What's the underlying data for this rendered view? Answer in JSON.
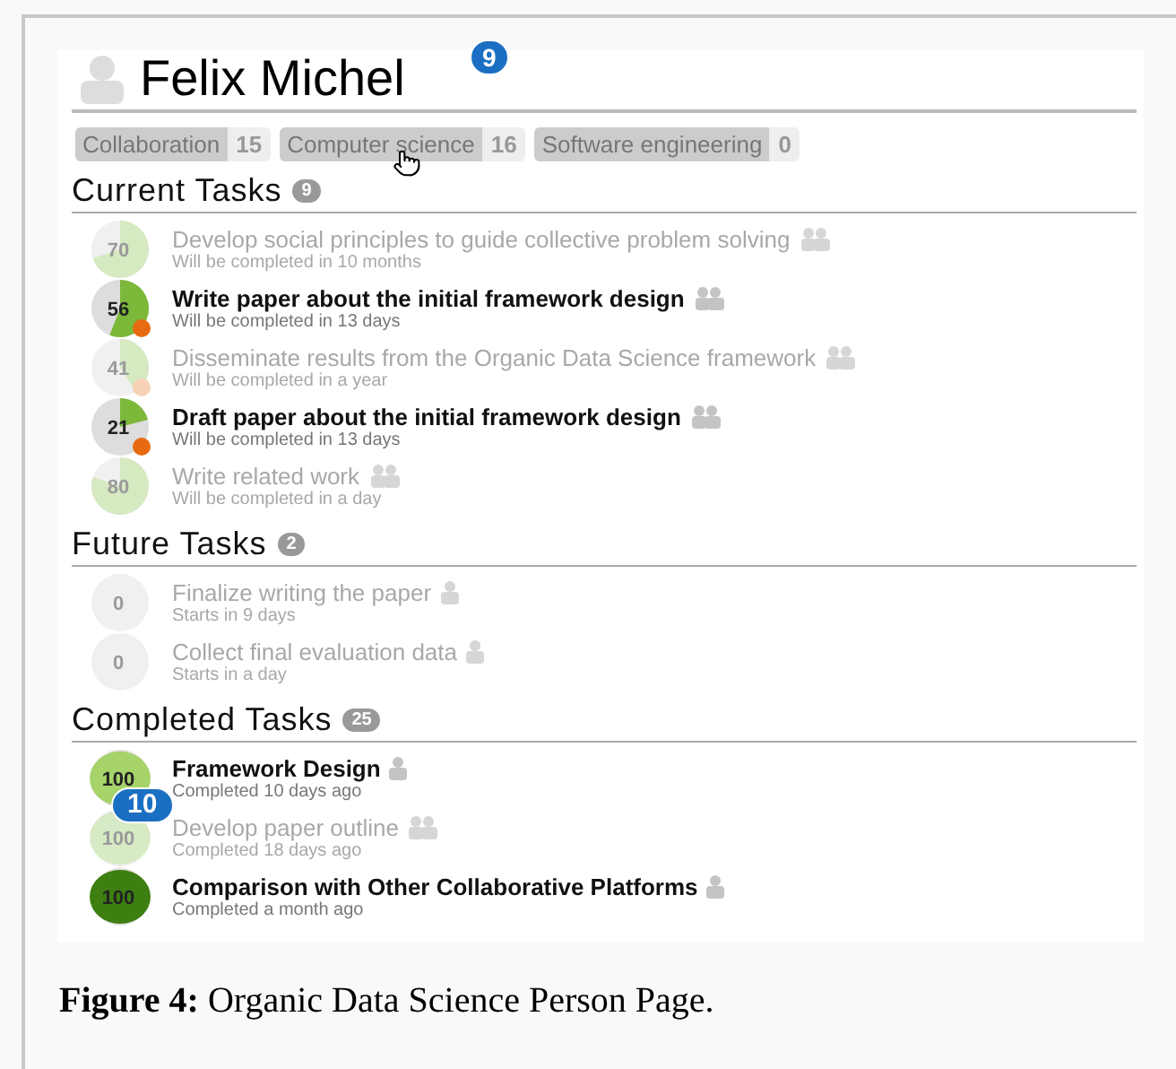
{
  "person": {
    "name": "Felix Michel",
    "callout": "9"
  },
  "tags": [
    {
      "label": "Collaboration",
      "count": "15",
      "hovered": false
    },
    {
      "label": "Computer science",
      "count": "16",
      "hovered": true
    },
    {
      "label": "Software engineering",
      "count": "0",
      "hovered": false
    }
  ],
  "sections": [
    {
      "title": "Current Tasks",
      "count": "9",
      "tasks": [
        {
          "progress": "70",
          "faded": true,
          "team": true,
          "title": "Develop social principles to guide collective problem solving",
          "subtitle": "Will be completed in 10 months"
        },
        {
          "progress": "56",
          "faded": false,
          "late": true,
          "team": true,
          "title": "Write paper about the initial framework design",
          "subtitle": "Will be completed in 13 days"
        },
        {
          "progress": "41",
          "faded": true,
          "late": true,
          "team": true,
          "title": "Disseminate results from the Organic Data Science framework",
          "subtitle": "Will be completed in a year"
        },
        {
          "progress": "21",
          "faded": false,
          "late": true,
          "team": true,
          "title": "Draft paper about the initial framework design",
          "subtitle": "Will be completed in 13 days"
        },
        {
          "progress": "80",
          "faded": true,
          "team": true,
          "title": "Write related work",
          "subtitle": "Will be completed in a day"
        }
      ]
    },
    {
      "title": "Future Tasks",
      "count": "2",
      "tasks": [
        {
          "progress": "0",
          "faded": true,
          "team": false,
          "title": "Finalize writing the paper",
          "subtitle": "Starts in 9 days"
        },
        {
          "progress": "0",
          "faded": true,
          "team": false,
          "title": "Collect final evaluation data",
          "subtitle": "Starts in a day"
        }
      ]
    },
    {
      "title": "Completed Tasks",
      "count": "25",
      "tasks": [
        {
          "progress": "100",
          "faded": false,
          "team": false,
          "color": "#a6d36a",
          "title": "Framework Design",
          "subtitle": "Completed 10 days ago",
          "callout": "10"
        },
        {
          "progress": "100",
          "faded": true,
          "team": true,
          "color": "#d8eac5",
          "title": "Develop paper outline",
          "subtitle": "Completed 18 days ago"
        },
        {
          "progress": "100",
          "faded": false,
          "team": false,
          "color": "#3d7f10",
          "title": "Comparison with Other Collaborative Platforms",
          "subtitle": "Completed  a month ago"
        }
      ]
    }
  ],
  "caption": "**Figure 4:** Organic Data Science Person Page."
}
